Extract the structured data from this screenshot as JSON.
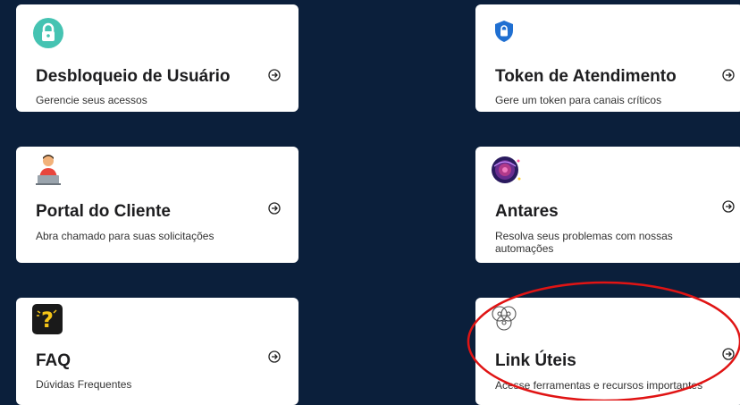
{
  "cards": [
    {
      "title": "Desbloqueio de Usuário",
      "description": "Gerencie seus acessos",
      "icon": "lock-icon"
    },
    {
      "title": "Token de Atendimento",
      "description": "Gere um token para canais críticos",
      "icon": "shield-lock-icon"
    },
    {
      "title": "Portal do Cliente",
      "description": "Abra chamado para suas solicitações",
      "icon": "person-laptop-icon"
    },
    {
      "title": "Antares",
      "description": "Resolva seus problemas com nossas automações",
      "icon": "galaxy-icon"
    },
    {
      "title": "FAQ",
      "description": "Dúvidas Frequentes",
      "icon": "question-icon"
    },
    {
      "title": "Link Úteis",
      "description": "Acesse ferramentas e recursos importantes",
      "icon": "network-icon"
    }
  ],
  "annotation": {
    "color": "#e01414"
  }
}
